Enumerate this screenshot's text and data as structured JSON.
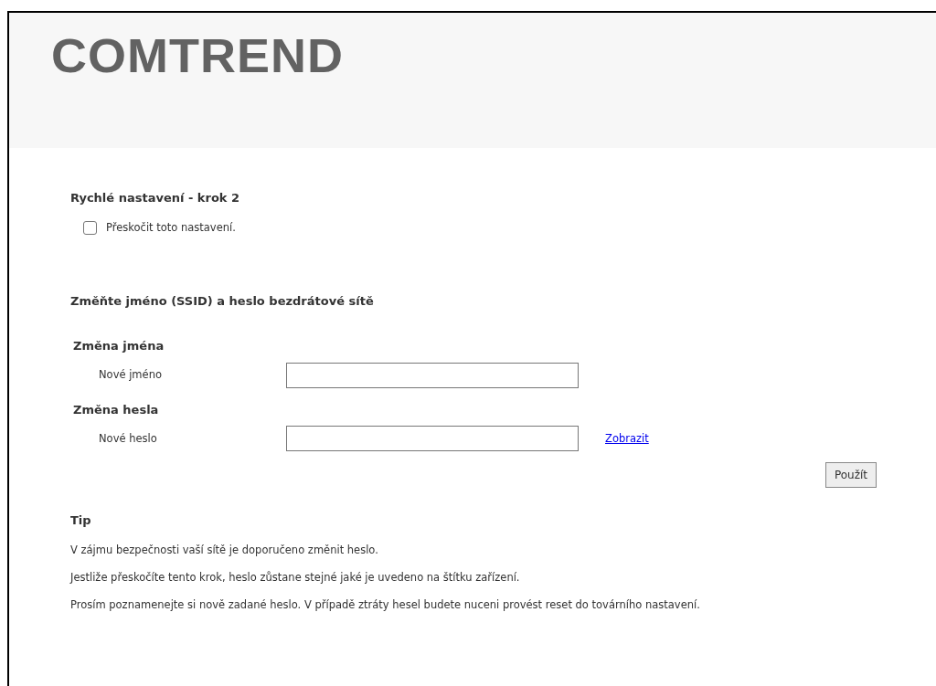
{
  "header": {
    "logo": "COMTREND"
  },
  "step": {
    "title": "Rychlé nastavení - krok 2",
    "skip": {
      "label": "Přeskočit toto nastavení.",
      "checked": false
    }
  },
  "wireless": {
    "title": "Změňte jméno (SSID) a heslo bezdrátové sítě",
    "groups": [
      {
        "title": "Změna jména",
        "label": "Nové jméno"
      },
      {
        "title": "Změna hesla",
        "label": "Nové heslo",
        "link": "Zobrazit"
      }
    ],
    "apply": "Použít"
  },
  "tip": {
    "title": "Tip",
    "lines": [
      "V zájmu bezpečnosti vaší sítě je doporučeno změnit heslo.",
      "Jestliže přeskočíte tento krok, heslo zůstane stejné jaké je uvedeno na štítku zařízení.",
      "Prosím poznamenejte si nově zadané heslo. V případě ztráty hesel budete nuceni provést reset do továrního nastavení."
    ]
  }
}
